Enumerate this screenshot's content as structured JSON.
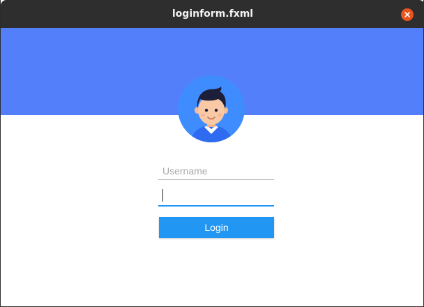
{
  "window": {
    "title": "loginform.fxml"
  },
  "icons": {
    "close": "close-icon",
    "avatar": "user-avatar-icon"
  },
  "form": {
    "username": {
      "placeholder": "Username",
      "value": ""
    },
    "password": {
      "value": "",
      "focused": true
    },
    "login_label": "Login"
  },
  "colors": {
    "titlebar": "#2e2e2e",
    "close_button": "#e9541f",
    "banner": "#547ffb",
    "accent": "#2196f3",
    "avatar_bg": "#3f8cff"
  }
}
